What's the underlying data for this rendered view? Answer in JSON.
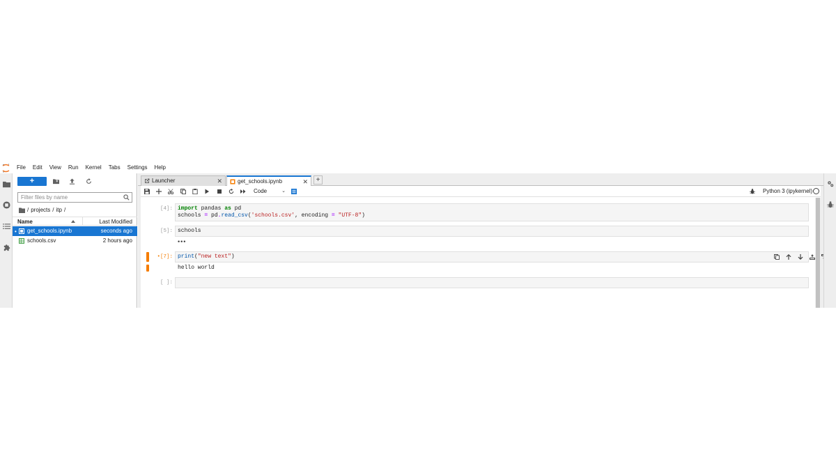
{
  "menubar": {
    "items": [
      "File",
      "Edit",
      "View",
      "Run",
      "Kernel",
      "Tabs",
      "Settings",
      "Help"
    ]
  },
  "filebrowser": {
    "new_label": "+",
    "filter_placeholder": "Filter files by name",
    "breadcrumb": [
      "/",
      "projects",
      "/",
      "itp",
      "/"
    ],
    "header": {
      "name": "Name",
      "modified": "Last Modified"
    },
    "files": [
      {
        "dot": "•",
        "name": "get_schools.ipynb",
        "modified": "seconds ago",
        "type": "notebook",
        "selected": true
      },
      {
        "dot": "",
        "name": "schools.csv",
        "modified": "2 hours ago",
        "type": "csv",
        "selected": false
      }
    ]
  },
  "tabs": [
    {
      "label": "Launcher",
      "close": "✕",
      "active": false
    },
    {
      "label": "get_schools.ipynb",
      "close": "✕",
      "active": true
    }
  ],
  "add_tab": "+",
  "notebook": {
    "cell_type": "Code",
    "kernel_name": "Python 3 (ipykernel)",
    "cells": [
      {
        "prompt": "[4]:",
        "code_lines": [
          [
            {
              "t": "import",
              "c": "kw"
            },
            {
              "t": " pandas ",
              "c": ""
            },
            {
              "t": "as",
              "c": "kw"
            },
            {
              "t": " pd",
              "c": ""
            }
          ],
          [
            {
              "t": "schools ",
              "c": ""
            },
            {
              "t": "=",
              "c": "op"
            },
            {
              "t": " pd",
              "c": ""
            },
            {
              "t": ".",
              "c": "op"
            },
            {
              "t": "read_csv",
              "c": "fn"
            },
            {
              "t": "(",
              "c": ""
            },
            {
              "t": "'schools.csv'",
              "c": "str"
            },
            {
              "t": ", encoding ",
              "c": ""
            },
            {
              "t": "=",
              "c": "op"
            },
            {
              "t": " ",
              "c": ""
            },
            {
              "t": "\"UTF-8\"",
              "c": "str"
            },
            {
              "t": ")",
              "c": ""
            }
          ]
        ]
      },
      {
        "prompt": "[5]:",
        "code": "schools",
        "output_collapsed": "•••"
      },
      {
        "prompt": "•[7]:",
        "code_parts": [
          {
            "t": "print",
            "c": "fn"
          },
          {
            "t": "(",
            "c": ""
          },
          {
            "t": "\"new text\"",
            "c": "str"
          },
          {
            "t": ")",
            "c": ""
          }
        ],
        "output": "hello world"
      },
      {
        "prompt": "[ ]:",
        "code": ""
      }
    ]
  },
  "colors": {
    "accent": "#1976d2",
    "active_cell": "#f57c00",
    "code_bg": "#f5f5f5"
  }
}
